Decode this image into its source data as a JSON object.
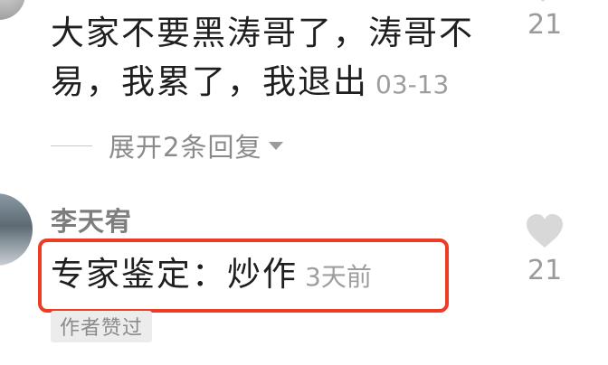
{
  "comment1": {
    "text": "大家不要黑涛哥了，涛哥不易，我累了，我退出",
    "time": "03-13",
    "likes": "21",
    "expand_replies": "展开2条回复"
  },
  "comment2": {
    "username": "李天宥",
    "text": "专家鉴定：炒作",
    "time": "3天前",
    "likes": "21",
    "badge": "作者赞过"
  },
  "colors": {
    "highlight_border": "#ee3b24",
    "muted_text": "#9e9e9e",
    "heart_fill": "#d8d8d8"
  },
  "icons": {
    "heart": "heart-icon",
    "caret": "chevron-down-icon"
  }
}
